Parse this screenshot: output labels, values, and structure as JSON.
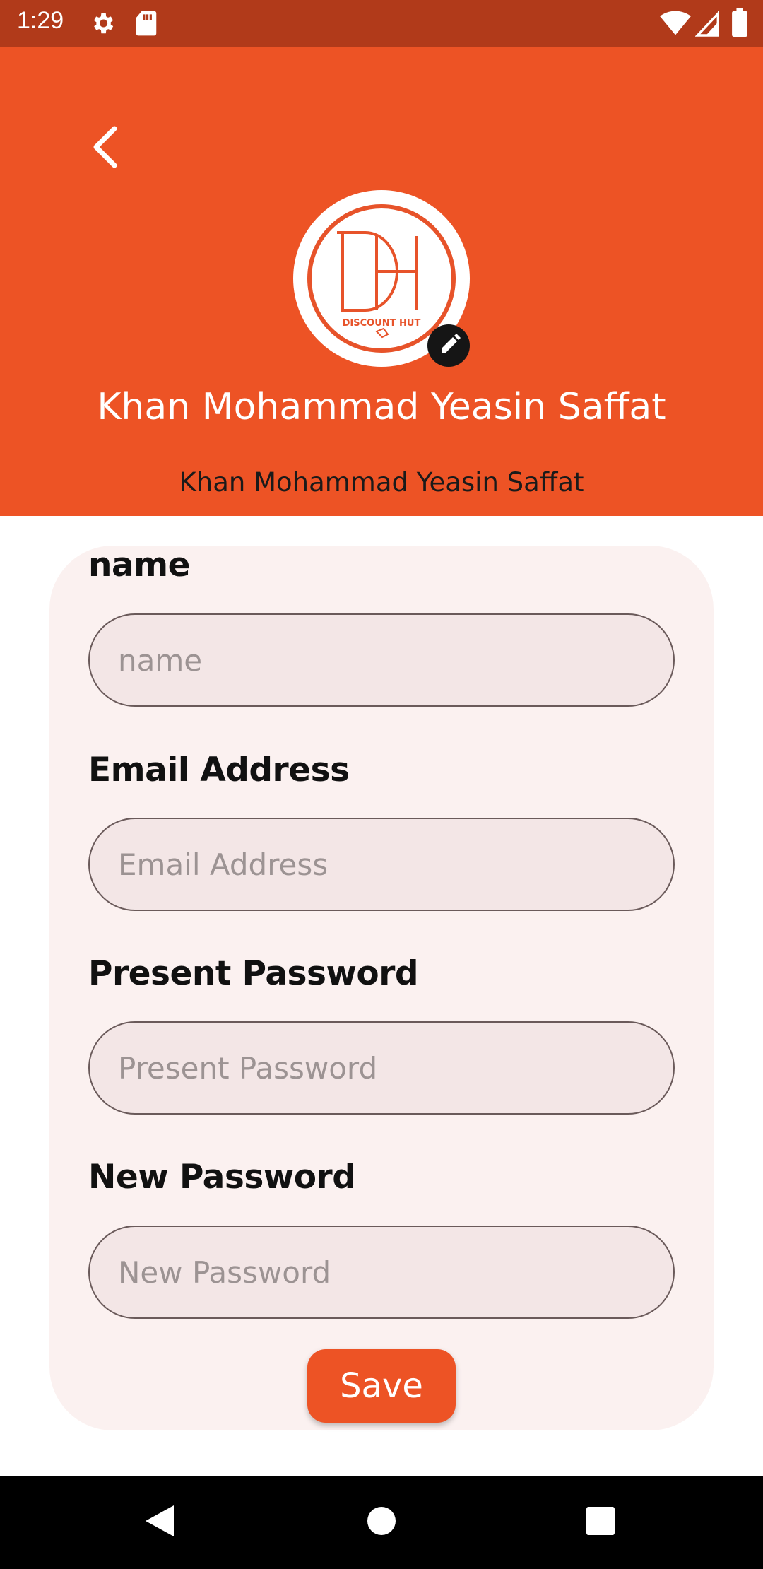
{
  "status_bar": {
    "time": "1:29",
    "icons": [
      "gear-icon",
      "sd-card-icon",
      "wifi-icon",
      "signal-icon",
      "battery-icon"
    ]
  },
  "header": {
    "back_icon": "chevron-left-icon",
    "avatar_logo_text": "DISCOUNT HUT",
    "edit_icon": "pencil-icon",
    "name": "Khan Mohammad Yeasin Saffat",
    "subtitle": "Khan Mohammad Yeasin Saffat"
  },
  "form": {
    "fields": [
      {
        "label": "name",
        "value": "",
        "placeholder": "name"
      },
      {
        "label": "Email Address",
        "value": "",
        "placeholder": "Email Address"
      },
      {
        "label": "Present Password",
        "value": "",
        "placeholder": "Present Password"
      },
      {
        "label": "New Password",
        "value": "",
        "placeholder": "New Password"
      }
    ],
    "save_label": "Save"
  },
  "nav_bar": {
    "icons": [
      "back-triangle-icon",
      "home-circle-icon",
      "recents-square-icon"
    ]
  },
  "colors": {
    "accent": "#ed5325",
    "status_bar": "#b13a1a",
    "card_bg": "#fbf1f0",
    "input_bg": "#f3e6e6"
  }
}
